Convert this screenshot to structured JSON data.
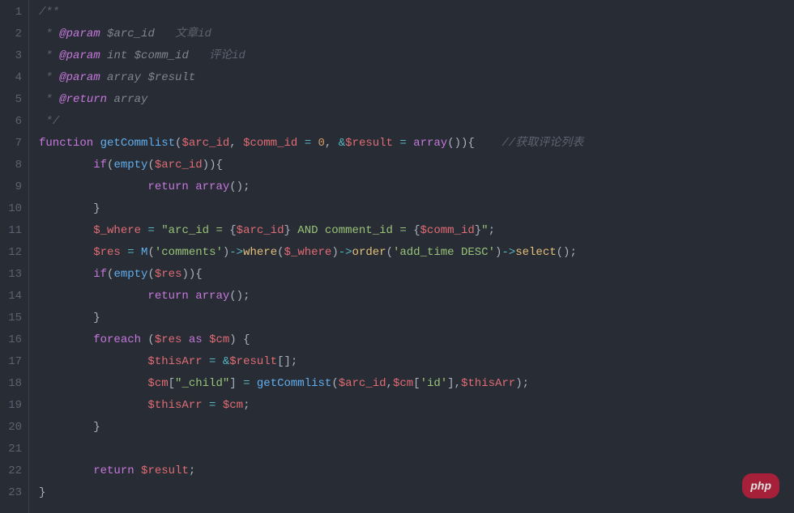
{
  "lineCount": 23,
  "tokens": [
    [
      {
        "t": "/**",
        "c": "c-comment"
      }
    ],
    [
      {
        "t": " * ",
        "c": "c-comment"
      },
      {
        "t": "@param",
        "c": "c-doctag"
      },
      {
        "t": " ",
        "c": "c-comment"
      },
      {
        "t": "$arc_id",
        "c": "c-docparam"
      },
      {
        "t": "   文章id",
        "c": "c-comment"
      }
    ],
    [
      {
        "t": " * ",
        "c": "c-comment"
      },
      {
        "t": "@param",
        "c": "c-doctag"
      },
      {
        "t": " ",
        "c": "c-comment"
      },
      {
        "t": "int $comm_id",
        "c": "c-docparam"
      },
      {
        "t": "   评论id",
        "c": "c-comment"
      }
    ],
    [
      {
        "t": " * ",
        "c": "c-comment"
      },
      {
        "t": "@param",
        "c": "c-doctag"
      },
      {
        "t": " ",
        "c": "c-comment"
      },
      {
        "t": "array $result",
        "c": "c-docparam"
      }
    ],
    [
      {
        "t": " * ",
        "c": "c-comment"
      },
      {
        "t": "@return",
        "c": "c-doctag"
      },
      {
        "t": " ",
        "c": "c-comment"
      },
      {
        "t": "array",
        "c": "c-docparam"
      }
    ],
    [
      {
        "t": " */",
        "c": "c-comment"
      }
    ],
    [
      {
        "t": "function",
        "c": "c-keyword"
      },
      {
        "t": " ",
        "c": "c-punct"
      },
      {
        "t": "getCommlist",
        "c": "c-funcname"
      },
      {
        "t": "(",
        "c": "c-punct"
      },
      {
        "t": "$arc_id",
        "c": "c-var"
      },
      {
        "t": ", ",
        "c": "c-punct"
      },
      {
        "t": "$comm_id",
        "c": "c-var"
      },
      {
        "t": " ",
        "c": "c-punct"
      },
      {
        "t": "=",
        "c": "c-op"
      },
      {
        "t": " ",
        "c": "c-punct"
      },
      {
        "t": "0",
        "c": "c-num"
      },
      {
        "t": ", ",
        "c": "c-punct"
      },
      {
        "t": "&",
        "c": "c-op"
      },
      {
        "t": "$result",
        "c": "c-var"
      },
      {
        "t": " ",
        "c": "c-punct"
      },
      {
        "t": "=",
        "c": "c-op"
      },
      {
        "t": " ",
        "c": "c-punct"
      },
      {
        "t": "array",
        "c": "c-keyword"
      },
      {
        "t": "()){    ",
        "c": "c-punct"
      },
      {
        "t": "//获取评论列表",
        "c": "c-comment"
      }
    ],
    [
      {
        "t": "        ",
        "c": "c-punct"
      },
      {
        "t": "if",
        "c": "c-keyword"
      },
      {
        "t": "(",
        "c": "c-punct"
      },
      {
        "t": "empty",
        "c": "c-funccall"
      },
      {
        "t": "(",
        "c": "c-punct"
      },
      {
        "t": "$arc_id",
        "c": "c-var"
      },
      {
        "t": ")){",
        "c": "c-punct"
      }
    ],
    [
      {
        "t": "                ",
        "c": "c-punct"
      },
      {
        "t": "return",
        "c": "c-keyword"
      },
      {
        "t": " ",
        "c": "c-punct"
      },
      {
        "t": "array",
        "c": "c-keyword"
      },
      {
        "t": "();",
        "c": "c-punct"
      }
    ],
    [
      {
        "t": "        }",
        "c": "c-punct"
      }
    ],
    [
      {
        "t": "        ",
        "c": "c-punct"
      },
      {
        "t": "$_where",
        "c": "c-var"
      },
      {
        "t": " ",
        "c": "c-punct"
      },
      {
        "t": "=",
        "c": "c-op"
      },
      {
        "t": " ",
        "c": "c-punct"
      },
      {
        "t": "\"arc_id = ",
        "c": "c-string"
      },
      {
        "t": "{",
        "c": "c-punct"
      },
      {
        "t": "$arc_id",
        "c": "c-var"
      },
      {
        "t": "}",
        "c": "c-punct"
      },
      {
        "t": " AND comment_id = ",
        "c": "c-string"
      },
      {
        "t": "{",
        "c": "c-punct"
      },
      {
        "t": "$comm_id",
        "c": "c-var"
      },
      {
        "t": "}",
        "c": "c-punct"
      },
      {
        "t": "\"",
        "c": "c-string"
      },
      {
        "t": ";",
        "c": "c-punct"
      }
    ],
    [
      {
        "t": "        ",
        "c": "c-punct"
      },
      {
        "t": "$res",
        "c": "c-var"
      },
      {
        "t": " ",
        "c": "c-punct"
      },
      {
        "t": "=",
        "c": "c-op"
      },
      {
        "t": " ",
        "c": "c-punct"
      },
      {
        "t": "M",
        "c": "c-funccall"
      },
      {
        "t": "(",
        "c": "c-punct"
      },
      {
        "t": "'comments'",
        "c": "c-string"
      },
      {
        "t": ")",
        "c": "c-punct"
      },
      {
        "t": "->",
        "c": "c-op"
      },
      {
        "t": "where",
        "c": "c-method"
      },
      {
        "t": "(",
        "c": "c-punct"
      },
      {
        "t": "$_where",
        "c": "c-var"
      },
      {
        "t": ")",
        "c": "c-punct"
      },
      {
        "t": "->",
        "c": "c-op"
      },
      {
        "t": "order",
        "c": "c-method"
      },
      {
        "t": "(",
        "c": "c-punct"
      },
      {
        "t": "'add_time DESC'",
        "c": "c-string"
      },
      {
        "t": ")",
        "c": "c-punct"
      },
      {
        "t": "->",
        "c": "c-op"
      },
      {
        "t": "select",
        "c": "c-method"
      },
      {
        "t": "();",
        "c": "c-punct"
      }
    ],
    [
      {
        "t": "        ",
        "c": "c-punct"
      },
      {
        "t": "if",
        "c": "c-keyword"
      },
      {
        "t": "(",
        "c": "c-punct"
      },
      {
        "t": "empty",
        "c": "c-funccall"
      },
      {
        "t": "(",
        "c": "c-punct"
      },
      {
        "t": "$res",
        "c": "c-var"
      },
      {
        "t": ")){",
        "c": "c-punct"
      }
    ],
    [
      {
        "t": "                ",
        "c": "c-punct"
      },
      {
        "t": "return",
        "c": "c-keyword"
      },
      {
        "t": " ",
        "c": "c-punct"
      },
      {
        "t": "array",
        "c": "c-keyword"
      },
      {
        "t": "();",
        "c": "c-punct"
      }
    ],
    [
      {
        "t": "        }",
        "c": "c-punct"
      }
    ],
    [
      {
        "t": "        ",
        "c": "c-punct"
      },
      {
        "t": "foreach",
        "c": "c-keyword"
      },
      {
        "t": " (",
        "c": "c-punct"
      },
      {
        "t": "$res",
        "c": "c-var"
      },
      {
        "t": " ",
        "c": "c-punct"
      },
      {
        "t": "as",
        "c": "c-keyword"
      },
      {
        "t": " ",
        "c": "c-punct"
      },
      {
        "t": "$cm",
        "c": "c-var"
      },
      {
        "t": ") {",
        "c": "c-punct"
      }
    ],
    [
      {
        "t": "                ",
        "c": "c-punct"
      },
      {
        "t": "$thisArr",
        "c": "c-var"
      },
      {
        "t": " ",
        "c": "c-punct"
      },
      {
        "t": "=",
        "c": "c-op"
      },
      {
        "t": " ",
        "c": "c-punct"
      },
      {
        "t": "&",
        "c": "c-op"
      },
      {
        "t": "$result",
        "c": "c-var"
      },
      {
        "t": "[];",
        "c": "c-punct"
      }
    ],
    [
      {
        "t": "                ",
        "c": "c-punct"
      },
      {
        "t": "$cm",
        "c": "c-var"
      },
      {
        "t": "[",
        "c": "c-punct"
      },
      {
        "t": "\"_child\"",
        "c": "c-string"
      },
      {
        "t": "] ",
        "c": "c-punct"
      },
      {
        "t": "=",
        "c": "c-op"
      },
      {
        "t": " ",
        "c": "c-punct"
      },
      {
        "t": "getCommlist",
        "c": "c-funccall"
      },
      {
        "t": "(",
        "c": "c-punct"
      },
      {
        "t": "$arc_id",
        "c": "c-var"
      },
      {
        "t": ",",
        "c": "c-punct"
      },
      {
        "t": "$cm",
        "c": "c-var"
      },
      {
        "t": "[",
        "c": "c-punct"
      },
      {
        "t": "'id'",
        "c": "c-string"
      },
      {
        "t": "],",
        "c": "c-punct"
      },
      {
        "t": "$thisArr",
        "c": "c-var"
      },
      {
        "t": ");",
        "c": "c-punct"
      }
    ],
    [
      {
        "t": "                ",
        "c": "c-punct"
      },
      {
        "t": "$thisArr",
        "c": "c-var"
      },
      {
        "t": " ",
        "c": "c-punct"
      },
      {
        "t": "=",
        "c": "c-op"
      },
      {
        "t": " ",
        "c": "c-punct"
      },
      {
        "t": "$cm",
        "c": "c-var"
      },
      {
        "t": ";",
        "c": "c-punct"
      }
    ],
    [
      {
        "t": "        }",
        "c": "c-punct"
      }
    ],
    [],
    [
      {
        "t": "        ",
        "c": "c-punct"
      },
      {
        "t": "return",
        "c": "c-keyword"
      },
      {
        "t": " ",
        "c": "c-punct"
      },
      {
        "t": "$result",
        "c": "c-var"
      },
      {
        "t": ";",
        "c": "c-punct"
      }
    ],
    [
      {
        "t": "}",
        "c": "c-punct"
      }
    ]
  ],
  "watermark": "php"
}
